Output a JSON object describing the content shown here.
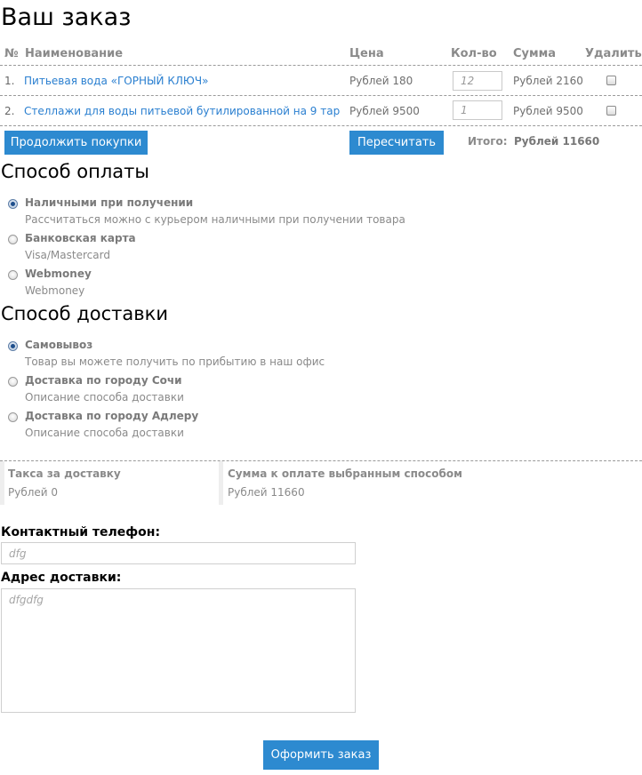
{
  "title": "Ваш заказ",
  "table": {
    "headers": {
      "num": "№",
      "name": "Наименование",
      "price": "Цена",
      "qty": "Кол-во",
      "sum": "Сумма",
      "delete": "Удалить"
    },
    "rows": [
      {
        "num": "1.",
        "name": "Питьевая вода «ГОРНЫЙ КЛЮЧ»",
        "price": "Рублей 180",
        "qty": "12",
        "sum": "Рублей 2160"
      },
      {
        "num": "2.",
        "name": "Стеллажи для воды питьевой бутилированной на 9 тар",
        "price": "Рублей 9500",
        "qty": "1",
        "sum": "Рублей 9500"
      }
    ]
  },
  "buttons": {
    "continue": "Продолжить покупки",
    "recalc": "Пересчитать",
    "submit": "Оформить заказ"
  },
  "total": {
    "label": "Итого:",
    "value": "Рублей 11660"
  },
  "payment": {
    "heading": "Способ оплаты",
    "options": [
      {
        "title": "Наличными при получении",
        "desc": "Рассчитаться можно с курьером наличными при получении товара",
        "selected": true
      },
      {
        "title": "Банковская карта",
        "desc": "Visa/Mastercard",
        "selected": false
      },
      {
        "title": "Webmoney",
        "desc": "Webmoney",
        "selected": false
      }
    ]
  },
  "delivery": {
    "heading": "Способ доставки",
    "options": [
      {
        "title": "Самовывоз",
        "desc": "Товар вы можете получить по прибытию в наш офис",
        "selected": true
      },
      {
        "title": "Доставка по городу Сочи",
        "desc": "Описание способа доставки",
        "selected": false
      },
      {
        "title": "Доставка по городу Адлеру",
        "desc": "Описание способа доставки",
        "selected": false
      }
    ]
  },
  "summary": {
    "fee_label": "Такса за доставку",
    "fee_value": "Рублей 0",
    "pay_label": "Сумма к оплате выбранным способом",
    "pay_value": "Рублей 11660"
  },
  "form": {
    "phone_label": "Контактный телефон:",
    "phone_value": "dfg",
    "address_label": "Адрес доставки:",
    "address_value": "dfgdfg"
  },
  "colors": {
    "accent": "#2d8ad0",
    "link": "#2a7fd0"
  }
}
